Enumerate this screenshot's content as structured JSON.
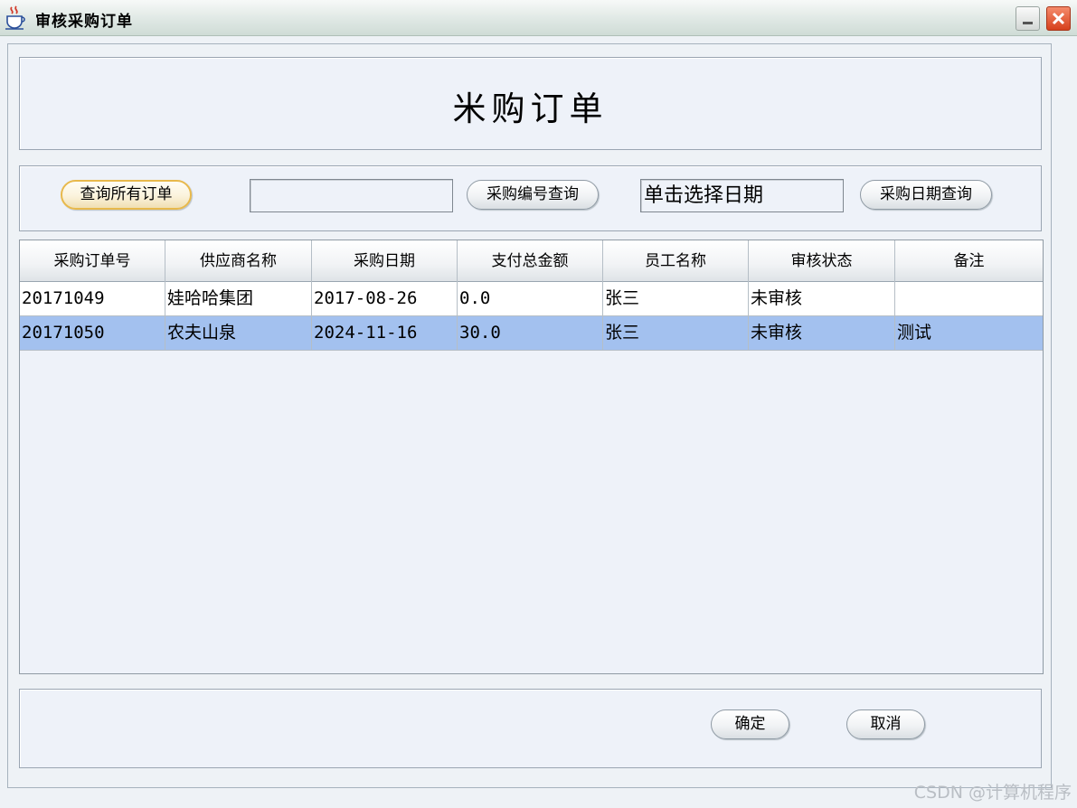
{
  "window": {
    "title": "审核采购订单",
    "icon": "java-cup-icon",
    "minimize_icon": "minimize-icon",
    "close_icon": "close-icon",
    "close_color": "#d6401c"
  },
  "header": {
    "title": "米购订单"
  },
  "query": {
    "all_orders_button": "查询所有订单",
    "order_no_input_value": "",
    "order_no_query_button": "采购编号查询",
    "date_input_value": "单击选择日期",
    "date_query_button": "采购日期查询"
  },
  "table": {
    "columns": [
      "采购订单号",
      "供应商名称",
      "采购日期",
      "支付总金额",
      "员工名称",
      "审核状态",
      "备注"
    ],
    "rows": [
      [
        "20171049",
        "娃哈哈集团",
        "2017-08-26",
        "0.0",
        "张三",
        "未审核",
        ""
      ],
      [
        "20171050",
        "农夫山泉",
        "2024-11-16",
        "30.0",
        "张三",
        "未审核",
        "测试"
      ]
    ],
    "selected_row_color": "#a3c1ef"
  },
  "footer": {
    "confirm_button": "确定",
    "cancel_button": "取消"
  },
  "watermark": "CSDN @计算机程序"
}
